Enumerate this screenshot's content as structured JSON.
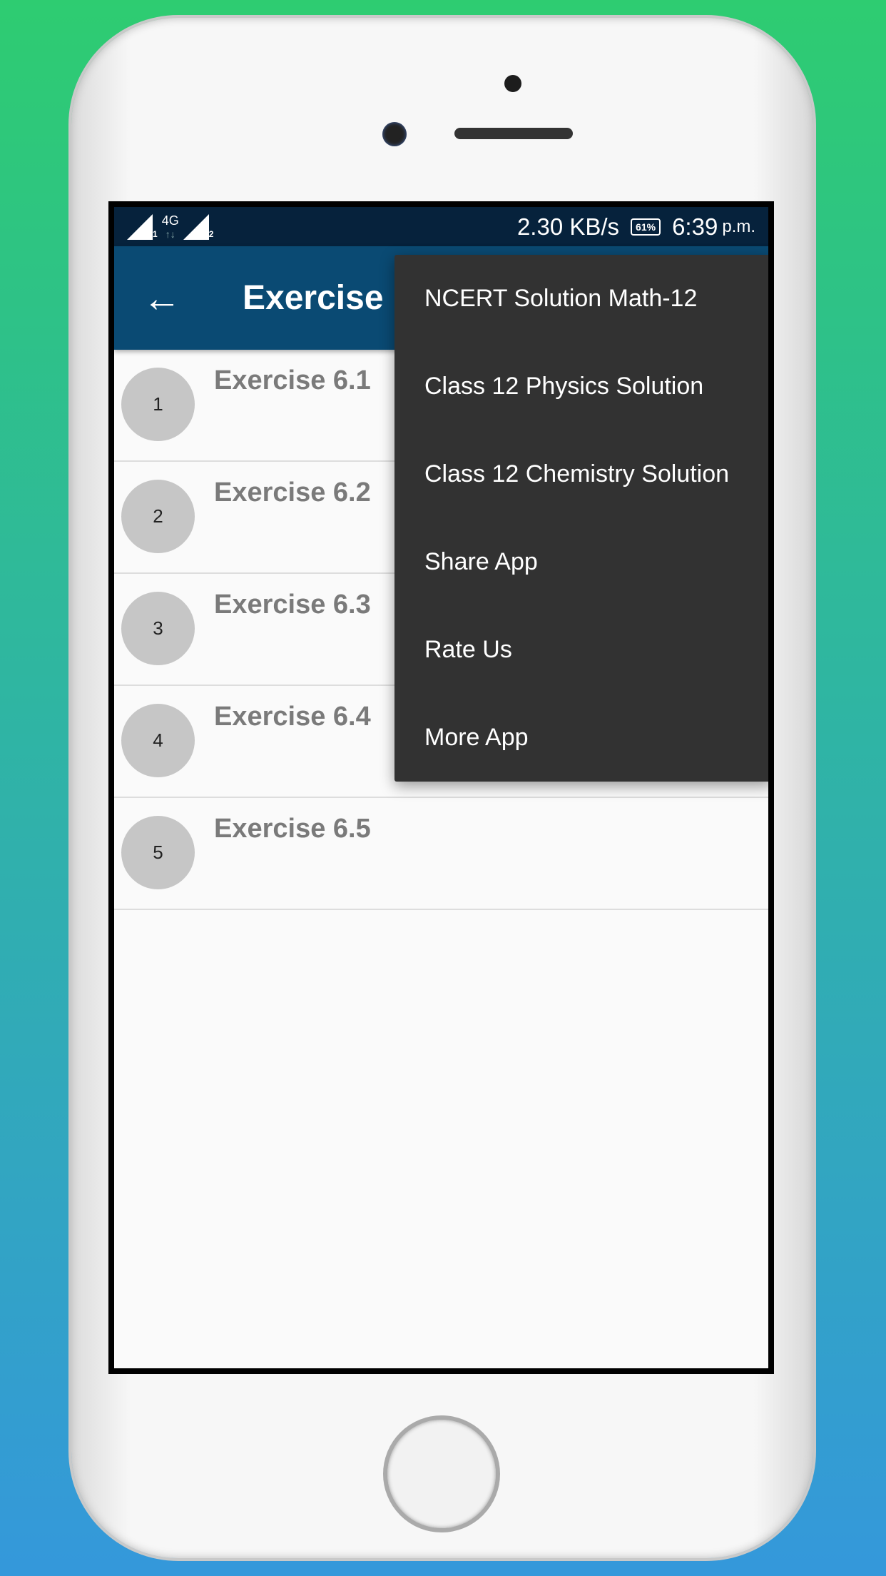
{
  "status_bar": {
    "sim1": "1",
    "network": "4G",
    "sim2": "2",
    "speed": "2.30 KB/s",
    "battery": "61%",
    "time": "6:39",
    "ampm": "p.m."
  },
  "app_bar": {
    "back_icon": "arrow-left",
    "title": "Exercise"
  },
  "exercises": [
    {
      "number": "1",
      "label": "Exercise 6.1"
    },
    {
      "number": "2",
      "label": "Exercise 6.2"
    },
    {
      "number": "3",
      "label": "Exercise 6.3"
    },
    {
      "number": "4",
      "label": "Exercise 6.4"
    },
    {
      "number": "5",
      "label": "Exercise 6.5"
    }
  ],
  "menu": {
    "items": [
      "NCERT Solution Math-12",
      "Class 12 Physics Solution",
      "Class 12 Chemistry Solution",
      "Share App",
      "Rate Us",
      "More App"
    ]
  },
  "colors": {
    "app_bar": "#0a4a73",
    "status_bar": "#06223c",
    "menu": "#323232"
  }
}
